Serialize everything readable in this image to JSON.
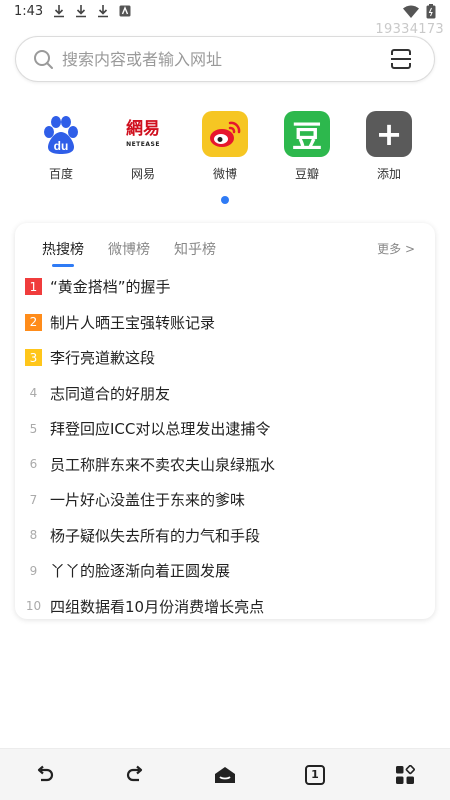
{
  "status_bar": {
    "time": "1:43",
    "watermark": "19334173"
  },
  "search": {
    "placeholder": "搜索内容或者输入网址"
  },
  "shortcuts": [
    {
      "label": "百度",
      "icon": "baidu-icon",
      "bg": "#ffffff"
    },
    {
      "label": "网易",
      "icon": "netease-icon",
      "bg": "#ffffff",
      "logo_text": "網易",
      "logo_sub": "NETEASE"
    },
    {
      "label": "微博",
      "icon": "weibo-icon",
      "bg": "#f6c623"
    },
    {
      "label": "豆瓣",
      "icon": "douban-icon",
      "bg": "#2db84d",
      "logo_text": "豆"
    },
    {
      "label": "添加",
      "icon": "add-icon",
      "bg": "#5a5a5a",
      "logo_text": "+"
    }
  ],
  "hot_card": {
    "tabs": [
      "热搜榜",
      "微博榜",
      "知乎榜"
    ],
    "active_tab": 0,
    "more": "更多 >",
    "items": [
      {
        "rank": "1",
        "title": "“黄金搭档”的握手",
        "color": "#f03c3c"
      },
      {
        "rank": "2",
        "title": "制片人晒王宝强转账记录",
        "color": "#ff8c1a"
      },
      {
        "rank": "3",
        "title": "李行亮道歉这段",
        "color": "#ffc61a"
      },
      {
        "rank": "4",
        "title": "志同道合的好朋友"
      },
      {
        "rank": "5",
        "title": "拜登回应ICC对以总理发出逮捕令"
      },
      {
        "rank": "6",
        "title": "员工称胖东来不卖农夫山泉绿瓶水"
      },
      {
        "rank": "7",
        "title": "一片好心没盖住于东来的爹味"
      },
      {
        "rank": "8",
        "title": "杨子疑似失去所有的力气和手段"
      },
      {
        "rank": "9",
        "title": "丫丫的脸逐渐向着正圆发展"
      },
      {
        "rank": "10",
        "title": "四组数据看10月份消费增长亮点"
      }
    ]
  },
  "bottom_bar": {
    "tab_count": "1",
    "buttons": [
      "back-icon",
      "forward-icon",
      "home-icon",
      "tabs-icon",
      "menu-icon"
    ]
  },
  "colors": {
    "accent": "#2f7bf5"
  }
}
